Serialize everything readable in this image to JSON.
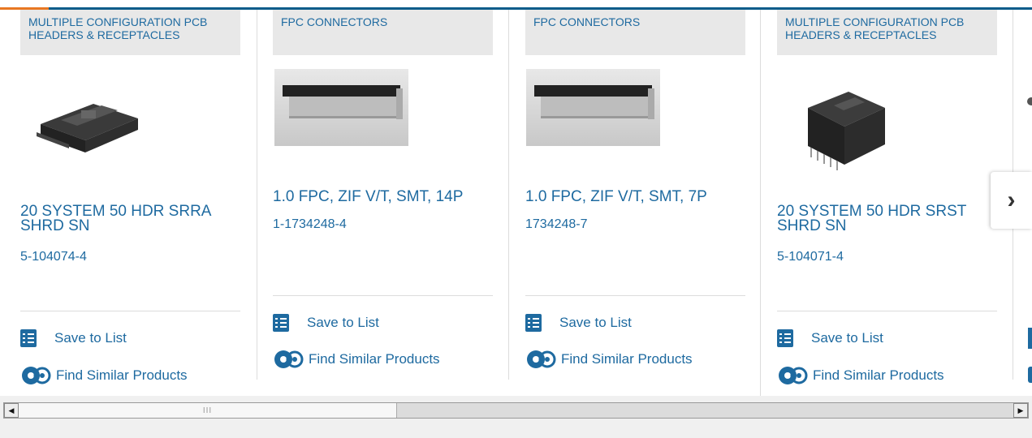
{
  "products": [
    {
      "category": "MULTIPLE CONFIGURATION PCB HEADERS & RECEPTACLES",
      "name": "20 SYSTEM 50 HDR SRRA SHRD SN",
      "part_number": "5-104074-4",
      "image_icon": "board-connector-photo"
    },
    {
      "category": "FPC CONNECTORS",
      "name": "1.0 FPC, ZIF V/T, SMT, 14P",
      "part_number": "1-1734248-4",
      "image_icon": "fpc-connector-photo"
    },
    {
      "category": "FPC CONNECTORS",
      "name": "1.0 FPC, ZIF V/T, SMT, 7P",
      "part_number": "1734248-7",
      "image_icon": "fpc-connector-photo"
    },
    {
      "category": "MULTIPLE CONFIGURATION PCB HEADERS & RECEPTACLES",
      "name": "20 SYSTEM 50 HDR SRST SHRD SN",
      "part_number": "5-104071-4",
      "image_icon": "header-connector-photo"
    }
  ],
  "actions": {
    "save_label": "Save to List",
    "similar_label": "Find Similar Products"
  },
  "carousel": {
    "next_glyph": "›"
  },
  "scrollbar": {
    "left_arrow": "◀",
    "right_arrow": "▶",
    "grip": "III"
  },
  "colors": {
    "link": "#1e6aa0",
    "top_bar": "#0a5c8a",
    "accent": "#e87722",
    "category_bg": "#e8e8e8"
  }
}
